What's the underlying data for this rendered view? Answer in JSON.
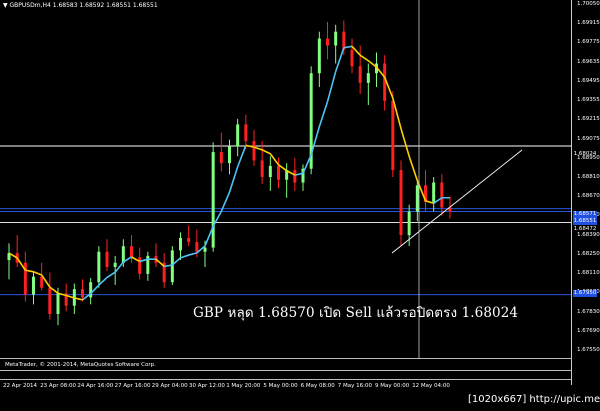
{
  "window": {
    "symbol_info": "▼ GBPUSDm,H4  1.68583 1.68592 1.68551 1.68551",
    "copyright": "MetaTrader, © 2001-2014, MetaQuotes Software Corp.",
    "watermark": "[1020x667] http://upic.me/"
  },
  "annotation": {
    "text": "GBP หลุด 1.68570  เปิด Sell  แล้วรอปิดตรง 1.68024"
  },
  "price_axis": {
    "labels": [
      "1.70050",
      "1.69915",
      "1.69775",
      "1.69635",
      "1.69495",
      "1.69355",
      "1.69215",
      "1.69075",
      "1.68950",
      "1.68810",
      "1.68670",
      "1.68530",
      "1.68390",
      "1.68250",
      "1.68110",
      "1.67970",
      "1.67830",
      "1.67690",
      "1.67550"
    ],
    "tag_h_line": "1.68024",
    "tag_current_a": "1.68571",
    "tag_current_b": "1.68551",
    "tag_lower": "1.68472",
    "tag_level": "1.67950"
  },
  "time_axis": {
    "labels": [
      "22 Apr 2014",
      "23 Apr 08:00",
      "24 Apr 16:00",
      "27 Apr 16:00",
      "29 Apr 04:00",
      "30 Apr 12:00",
      "1 May 20:00",
      "5 May 00:00",
      "6 May 08:00",
      "7 May 16:00",
      "9 May 00:00",
      "12 May 04:00"
    ]
  },
  "colors": {
    "background": "#000000",
    "bull_candle": "#80ff80",
    "bear_candle": "#ff2020",
    "ma_up": "#4fc3f7",
    "ma_down": "#ffd000",
    "h_line_blue": "#3060ff",
    "h_line_white": "#ffffff",
    "trend_line": "#ffffff"
  },
  "chart_data": {
    "type": "candlestick",
    "symbol": "GBPUSDm",
    "timeframe": "H4",
    "ohlc_current": {
      "open": 1.68583,
      "high": 1.68592,
      "low": 1.68551,
      "close": 1.68551
    },
    "ylim": [
      1.6755,
      1.7005
    ],
    "horizontal_levels": [
      1.69024,
      1.68571,
      1.68551,
      1.68472,
      1.6795
    ],
    "annotation_levels": {
      "sell_entry": 1.6857,
      "target": 1.68024
    },
    "candles": [
      [
        1.682,
        1.6832,
        1.6806,
        1.6825
      ],
      [
        1.6825,
        1.6838,
        1.6815,
        1.6818
      ],
      [
        1.6818,
        1.6826,
        1.679,
        1.6795
      ],
      [
        1.6795,
        1.6812,
        1.6788,
        1.6808
      ],
      [
        1.6808,
        1.6818,
        1.6798,
        1.68
      ],
      [
        1.68,
        1.6811,
        1.6777,
        1.6781
      ],
      [
        1.6781,
        1.68,
        1.6773,
        1.6796
      ],
      [
        1.6796,
        1.6803,
        1.6783,
        1.6787
      ],
      [
        1.6787,
        1.6803,
        1.6781,
        1.6799
      ],
      [
        1.6799,
        1.6806,
        1.679,
        1.6793
      ],
      [
        1.6793,
        1.6807,
        1.6788,
        1.6804
      ],
      [
        1.6804,
        1.683,
        1.68,
        1.6826
      ],
      [
        1.6826,
        1.6835,
        1.6812,
        1.6815
      ],
      [
        1.6815,
        1.6823,
        1.6802,
        1.6818
      ],
      [
        1.6818,
        1.6835,
        1.6815,
        1.683
      ],
      [
        1.683,
        1.6838,
        1.6818,
        1.6822
      ],
      [
        1.6822,
        1.6829,
        1.6806,
        1.681
      ],
      [
        1.681,
        1.6826,
        1.6805,
        1.6823
      ],
      [
        1.6823,
        1.6832,
        1.6815,
        1.6818
      ],
      [
        1.6818,
        1.6825,
        1.68,
        1.6804
      ],
      [
        1.6804,
        1.683,
        1.6802,
        1.6827
      ],
      [
        1.6827,
        1.684,
        1.682,
        1.6836
      ],
      [
        1.6836,
        1.6845,
        1.683,
        1.6833
      ],
      [
        1.6833,
        1.6842,
        1.6822,
        1.6826
      ],
      [
        1.6826,
        1.6834,
        1.6815,
        1.6829
      ],
      [
        1.6829,
        1.6905,
        1.6826,
        1.6898
      ],
      [
        1.6898,
        1.6912,
        1.6884,
        1.689
      ],
      [
        1.689,
        1.6907,
        1.6882,
        1.6902
      ],
      [
        1.6902,
        1.6922,
        1.6895,
        1.6918
      ],
      [
        1.6918,
        1.6925,
        1.69,
        1.6906
      ],
      [
        1.6906,
        1.6914,
        1.6888,
        1.6892
      ],
      [
        1.6892,
        1.6906,
        1.6875,
        1.688
      ],
      [
        1.688,
        1.6895,
        1.687,
        1.6888
      ],
      [
        1.6888,
        1.6894,
        1.6872,
        1.6878
      ],
      [
        1.6878,
        1.689,
        1.6865,
        1.6885
      ],
      [
        1.6885,
        1.6894,
        1.687,
        1.6876
      ],
      [
        1.6876,
        1.6889,
        1.687,
        1.6886
      ],
      [
        1.6886,
        1.696,
        1.6882,
        1.6955
      ],
      [
        1.6955,
        1.6985,
        1.6945,
        1.698
      ],
      [
        1.698,
        1.6992,
        1.6965,
        1.6975
      ],
      [
        1.6975,
        1.699,
        1.6962,
        1.6985
      ],
      [
        1.6985,
        1.6993,
        1.6968,
        1.6972
      ],
      [
        1.6972,
        1.698,
        1.6955,
        1.696
      ],
      [
        1.696,
        1.6975,
        1.694,
        1.6948
      ],
      [
        1.6948,
        1.6962,
        1.6932,
        1.6955
      ],
      [
        1.6955,
        1.697,
        1.6945,
        1.6962
      ],
      [
        1.6962,
        1.6968,
        1.6928,
        1.6935
      ],
      [
        1.6935,
        1.6942,
        1.688,
        1.6885
      ],
      [
        1.6885,
        1.6892,
        1.683,
        1.6838
      ],
      [
        1.6838,
        1.686,
        1.683,
        1.6855
      ],
      [
        1.6855,
        1.6878,
        1.6848,
        1.6874
      ],
      [
        1.6874,
        1.6885,
        1.6855,
        1.6862
      ],
      [
        1.6862,
        1.688,
        1.6855,
        1.6876
      ],
      [
        1.6876,
        1.6882,
        1.6852,
        1.6858
      ],
      [
        1.6858,
        1.6866,
        1.685,
        1.6855
      ]
    ]
  }
}
